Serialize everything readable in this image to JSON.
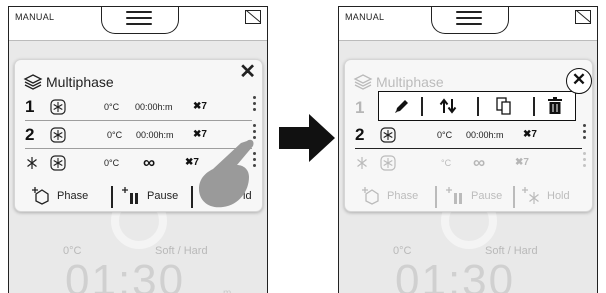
{
  "colors": {
    "panel_bg": "#f7f7f7",
    "screen_bg": "#e9e9e9",
    "text": "#222222",
    "dimmed": "#c8c8c8",
    "arrow": "#111111"
  },
  "topbar": {
    "mode_label": "MANUAL",
    "menu_icon": "hamburger-icon",
    "status_icon": "no-signal-icon"
  },
  "background": {
    "temp": "0°C",
    "mode": "Soft / Hard",
    "time": "01:30",
    "unit": "m"
  },
  "panel": {
    "title": "Multiphase",
    "close_label": "✕",
    "rows": [
      {
        "num": "1",
        "temp": "0°C",
        "duration": "00:00h:m",
        "fan": "7"
      },
      {
        "num": "2",
        "temp": "0°C",
        "duration": "00:00h:m",
        "fan": "7"
      },
      {
        "num": "",
        "temp": "0°C",
        "duration": "∞",
        "fan": "7"
      }
    ],
    "actions": [
      {
        "label": "Phase",
        "icon": "add-phase-icon"
      },
      {
        "label": "Pause",
        "icon": "add-pause-icon"
      },
      {
        "label": "Hold",
        "icon": "add-hold-icon"
      }
    ],
    "partial_hold": "ld"
  },
  "edit_toolbar": {
    "buttons": [
      "edit-pencil-icon",
      "reorder-arrows-icon",
      "duplicate-icon",
      "delete-trash-icon"
    ],
    "close_label": "✕",
    "dim_temp": "°C"
  }
}
